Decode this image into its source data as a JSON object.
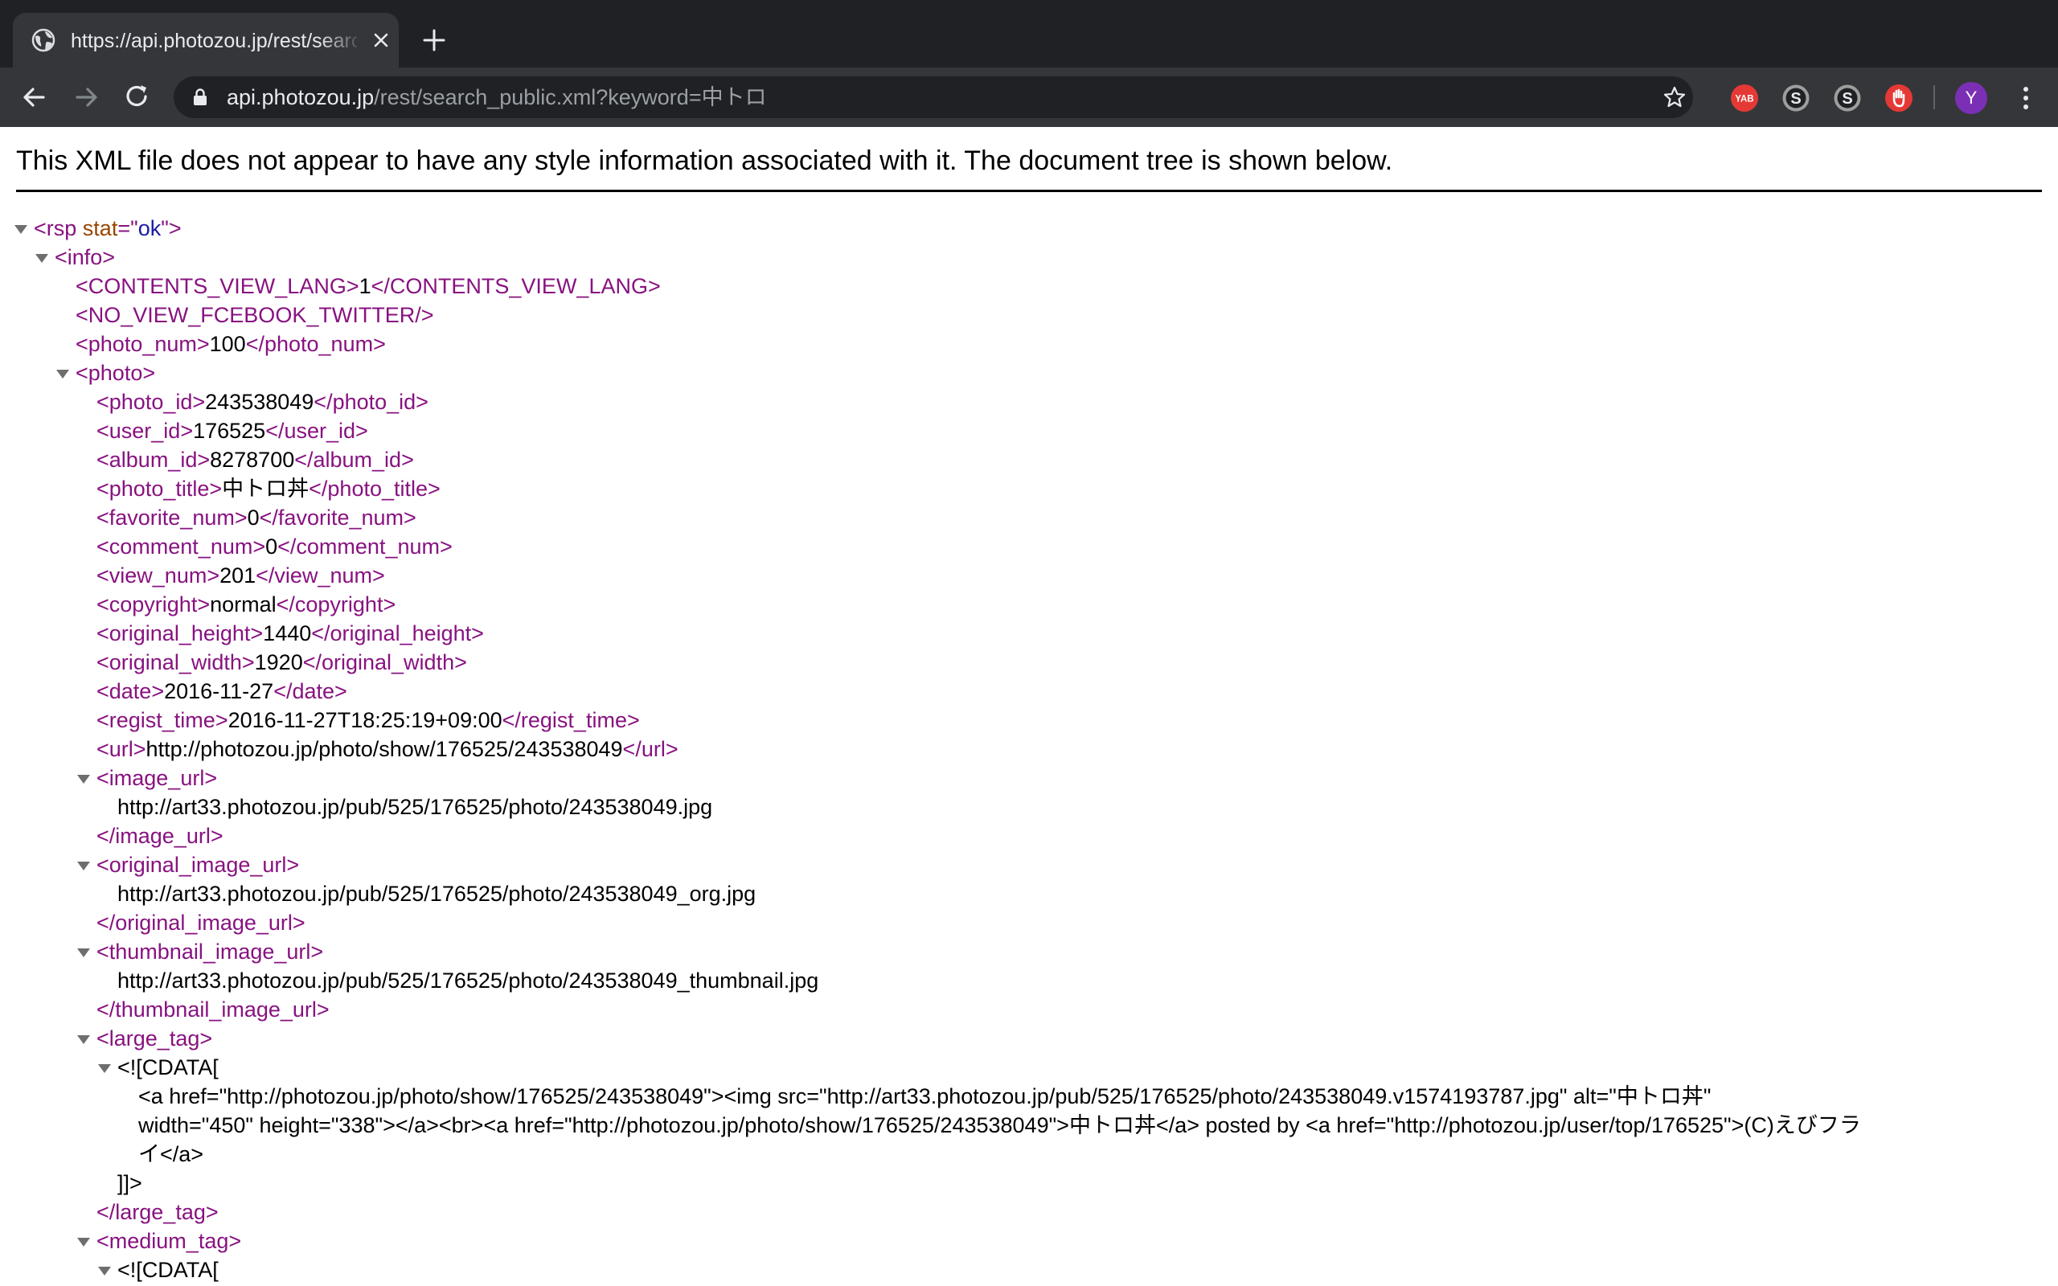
{
  "browser": {
    "tab_title": "https://api.photozou.jp/rest/search_public.xml?keyword=中トロ",
    "url_host": "api.photozou.jp",
    "url_path": "/rest/search_public.xml?keyword=中トロ",
    "extensions": [
      {
        "name": "yab-extension-icon",
        "label": "YAB",
        "color": "#e53935"
      },
      {
        "name": "s-extension-icon",
        "label": "S",
        "color": "#9e9e9e"
      },
      {
        "name": "s-extension-icon-2",
        "label": "S",
        "color": "#9e9e9e"
      },
      {
        "name": "hand-blocker-extension-icon",
        "label": "",
        "color": "#e53935"
      }
    ],
    "avatar_initial": "Y",
    "colors": {
      "tab_strip": "#202124",
      "toolbar": "#35363a",
      "omnibox": "#202124",
      "avatar": "#7b2fb5"
    }
  },
  "page": {
    "notice": "This XML file does not appear to have any style information associated with it. The document tree is shown below.",
    "lines": [
      {
        "indent": 0,
        "toggle": true,
        "open": "<rsp",
        "attr_name": "stat",
        "attr_value": "ok",
        "open_end": ">"
      },
      {
        "indent": 1,
        "toggle": true,
        "open": "<info>"
      },
      {
        "indent": 2,
        "open": "<CONTENTS_VIEW_LANG>",
        "text": "1",
        "close": "</CONTENTS_VIEW_LANG>"
      },
      {
        "indent": 2,
        "open": "<NO_VIEW_FCEBOOK_TWITTER/>"
      },
      {
        "indent": 2,
        "open": "<photo_num>",
        "text": "100",
        "close": "</photo_num>"
      },
      {
        "indent": 2,
        "toggle": true,
        "open": "<photo>"
      },
      {
        "indent": 3,
        "open": "<photo_id>",
        "text": "243538049",
        "close": "</photo_id>"
      },
      {
        "indent": 3,
        "open": "<user_id>",
        "text": "176525",
        "close": "</user_id>"
      },
      {
        "indent": 3,
        "open": "<album_id>",
        "text": "8278700",
        "close": "</album_id>"
      },
      {
        "indent": 3,
        "open": "<photo_title>",
        "text": "中トロ丼",
        "close": "</photo_title>"
      },
      {
        "indent": 3,
        "open": "<favorite_num>",
        "text": "0",
        "close": "</favorite_num>"
      },
      {
        "indent": 3,
        "open": "<comment_num>",
        "text": "0",
        "close": "</comment_num>"
      },
      {
        "indent": 3,
        "open": "<view_num>",
        "text": "201",
        "close": "</view_num>"
      },
      {
        "indent": 3,
        "open": "<copyright>",
        "text": "normal",
        "close": "</copyright>"
      },
      {
        "indent": 3,
        "open": "<original_height>",
        "text": "1440",
        "close": "</original_height>"
      },
      {
        "indent": 3,
        "open": "<original_width>",
        "text": "1920",
        "close": "</original_width>"
      },
      {
        "indent": 3,
        "open": "<date>",
        "text": "2016-11-27",
        "close": "</date>"
      },
      {
        "indent": 3,
        "open": "<regist_time>",
        "text": "2016-11-27T18:25:19+09:00",
        "close": "</regist_time>"
      },
      {
        "indent": 3,
        "open": "<url>",
        "text": "http://photozou.jp/photo/show/176525/243538049",
        "close": "</url>"
      },
      {
        "indent": 3,
        "toggle": true,
        "open": "<image_url>"
      },
      {
        "indent": 4,
        "text": "http://art33.photozou.jp/pub/525/176525/photo/243538049.jpg"
      },
      {
        "indent": 3,
        "close": "</image_url>"
      },
      {
        "indent": 3,
        "toggle": true,
        "open": "<original_image_url>"
      },
      {
        "indent": 4,
        "text": "http://art33.photozou.jp/pub/525/176525/photo/243538049_org.jpg"
      },
      {
        "indent": 3,
        "close": "</original_image_url>"
      },
      {
        "indent": 3,
        "toggle": true,
        "open": "<thumbnail_image_url>"
      },
      {
        "indent": 4,
        "text": "http://art33.photozou.jp/pub/525/176525/photo/243538049_thumbnail.jpg"
      },
      {
        "indent": 3,
        "close": "</thumbnail_image_url>"
      },
      {
        "indent": 3,
        "toggle": true,
        "open": "<large_tag>"
      },
      {
        "indent": 4,
        "toggle": true,
        "text": "<![CDATA["
      },
      {
        "indent": 5,
        "text": "<a href=\"http://photozou.jp/photo/show/176525/243538049\"><img src=\"http://art33.photozou.jp/pub/525/176525/photo/243538049.v1574193787.jpg\" alt=\"中トロ丼\""
      },
      {
        "indent": 5,
        "text": "width=\"450\" height=\"338\"></a><br><a href=\"http://photozou.jp/photo/show/176525/243538049\">中トロ丼</a> posted by <a href=\"http://photozou.jp/user/top/176525\">(C)えびフラ"
      },
      {
        "indent": 5,
        "text": "イ</a>"
      },
      {
        "indent": 4,
        "text": "]]>"
      },
      {
        "indent": 3,
        "close": "</large_tag>"
      },
      {
        "indent": 3,
        "toggle": true,
        "open": "<medium_tag>"
      },
      {
        "indent": 4,
        "toggle": true,
        "text": "<![CDATA["
      }
    ]
  }
}
